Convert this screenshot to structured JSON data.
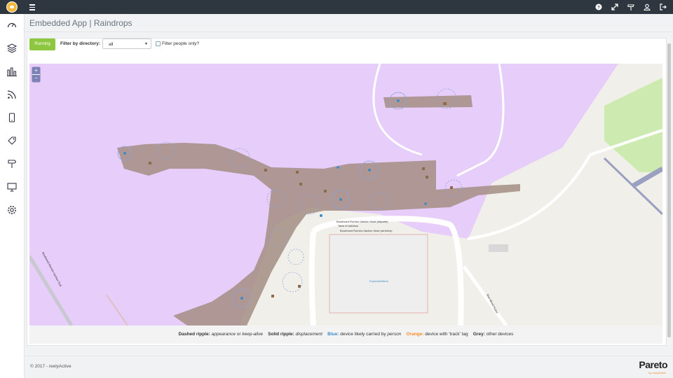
{
  "header": {
    "icons": [
      "help-icon",
      "expand-icon",
      "signpost-icon",
      "user-icon",
      "logout-icon"
    ]
  },
  "sidebar": {
    "icons": [
      "dashboard-icon",
      "layers-icon",
      "bar-chart-icon",
      "rss-icon",
      "mobile-icon",
      "tag-icon",
      "signpost-icon",
      "monitor-icon",
      "gear-icon"
    ]
  },
  "page": {
    "title": "Embedded App | Raindrops"
  },
  "controls": {
    "running_label": "Running",
    "filter_label": "Filter by directory:",
    "directory_value": "all",
    "people_only_label": "Filter people only?",
    "people_only_checked": false
  },
  "map": {
    "zoom_in": "+",
    "zoom_out": "−",
    "labels": {
      "road_departures": "Boulevard Roméo-Vachon Nord (départs)",
      "road_arrivals": "Boulevard Roméo-Vachon Nord (arrivées)",
      "road_taxi": "Taxis et autobus",
      "station": "Express/Ultimo",
      "street_left": "Boulevard Roméo-Vachon Sud",
      "street_right": "Rue Alfred-Nobel"
    }
  },
  "legend": {
    "dashed_title": "Dashed ripple:",
    "dashed_a": "appearance",
    "dashed_or": "or",
    "dashed_b": "keep-alive",
    "solid_title": "Solid ripple:",
    "solid_desc": "displacement",
    "blue_title": "Blue:",
    "blue_desc": "device likely carried by",
    "blue_person": "person",
    "orange_title": "Orange:",
    "orange_desc": "device with 'track' tag",
    "grey_title": "Grey:",
    "grey_desc": "other devices"
  },
  "footer": {
    "copyright": "© 2017 - reelyActive",
    "brand": "Pareto",
    "brand_sub": "by reelyActive"
  },
  "colors": {
    "topbar": "#2e3740",
    "running": "#8dc63f",
    "airside": "#e6cdfa",
    "terminal": "#a38d82",
    "park": "#cdebb0",
    "blue_device": "#3c8bc6",
    "orange_device": "#f58a2b"
  }
}
